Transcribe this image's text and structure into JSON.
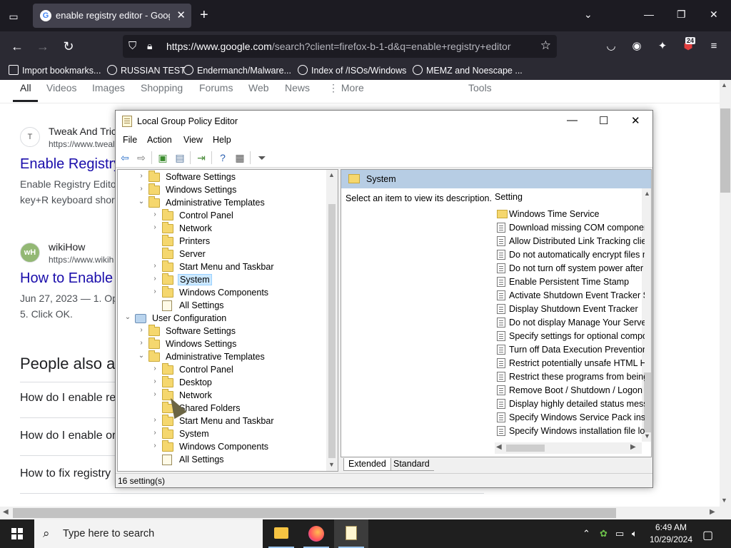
{
  "firefox": {
    "tab_title": "enable registry editor - Google Search",
    "url_host": "https://www.google.com",
    "url_rest": "/search?client=firefox-b-1-d&q=enable+registry+editor",
    "badge": "24",
    "bookmarks": [
      "Import bookmarks...",
      "RUSSIAN TEST",
      "Endermanch/Malware...",
      "Index of /ISOs/Windows",
      "MEMZ and Noescape ..."
    ]
  },
  "google": {
    "tabs": [
      "All",
      "Videos",
      "Images",
      "Shopping",
      "Forums",
      "Web",
      "News",
      "⋮ More",
      "Tools"
    ],
    "results": [
      {
        "site": "Tweak And Tric",
        "url": "https://www.tweal",
        "title": "Enable Registry",
        "snip1": "Enable Registry Edito",
        "snip2": "key+R keyboard shor",
        "fav": "T"
      },
      {
        "site": "wikiHow",
        "url": "https://www.wikih",
        "title": "How to Enable",
        "snip1": "Jun 27, 2023 — 1. Op",
        "snip2": "5. Click OK.",
        "fav": "wH"
      }
    ],
    "paa_heading": "People also a",
    "paa": [
      "How do I enable re",
      "How do I enable or",
      "How to fix registry"
    ]
  },
  "gpedit": {
    "title": "Local Group Policy Editor",
    "menu": [
      "File",
      "Action",
      "View",
      "Help"
    ],
    "tree": [
      {
        "label": "Software Settings",
        "indent": 1,
        "chev": "›",
        "icon": "folder"
      },
      {
        "label": "Windows Settings",
        "indent": 1,
        "chev": "›",
        "icon": "folder"
      },
      {
        "label": "Administrative Templates",
        "indent": 1,
        "chev": "⌄",
        "icon": "folder"
      },
      {
        "label": "Control Panel",
        "indent": 2,
        "chev": "›",
        "icon": "folder"
      },
      {
        "label": "Network",
        "indent": 2,
        "chev": "›",
        "icon": "folder"
      },
      {
        "label": "Printers",
        "indent": 2,
        "chev": "",
        "icon": "folder"
      },
      {
        "label": "Server",
        "indent": 2,
        "chev": "",
        "icon": "folder"
      },
      {
        "label": "Start Menu and Taskbar",
        "indent": 2,
        "chev": "›",
        "icon": "folder"
      },
      {
        "label": "System",
        "indent": 2,
        "chev": "›",
        "icon": "folder",
        "selected": true
      },
      {
        "label": "Windows Components",
        "indent": 2,
        "chev": "›",
        "icon": "folder"
      },
      {
        "label": "All Settings",
        "indent": 2,
        "chev": "",
        "icon": "policy"
      },
      {
        "label": "User Configuration",
        "indent": 0,
        "chev": "⌄",
        "icon": "pc"
      },
      {
        "label": "Software Settings",
        "indent": 1,
        "chev": "›",
        "icon": "folder"
      },
      {
        "label": "Windows Settings",
        "indent": 1,
        "chev": "›",
        "icon": "folder"
      },
      {
        "label": "Administrative Templates",
        "indent": 1,
        "chev": "⌄",
        "icon": "folder"
      },
      {
        "label": "Control Panel",
        "indent": 2,
        "chev": "›",
        "icon": "folder"
      },
      {
        "label": "Desktop",
        "indent": 2,
        "chev": "›",
        "icon": "folder"
      },
      {
        "label": "Network",
        "indent": 2,
        "chev": "›",
        "icon": "folder"
      },
      {
        "label": "Shared Folders",
        "indent": 2,
        "chev": "",
        "icon": "folder"
      },
      {
        "label": "Start Menu and Taskbar",
        "indent": 2,
        "chev": "›",
        "icon": "folder"
      },
      {
        "label": "System",
        "indent": 2,
        "chev": "›",
        "icon": "folder"
      },
      {
        "label": "Windows Components",
        "indent": 2,
        "chev": "›",
        "icon": "folder"
      },
      {
        "label": "All Settings",
        "indent": 2,
        "chev": "",
        "icon": "policy"
      }
    ],
    "right_header": "System",
    "description": "Select an item to view its description.",
    "setting_col": "Setting",
    "settings": [
      {
        "label": "Windows Time Service",
        "icon": "folder"
      },
      {
        "label": "Download missing COM components",
        "icon": "doc"
      },
      {
        "label": "Allow Distributed Link Tracking client",
        "icon": "doc"
      },
      {
        "label": "Do not automatically encrypt files moved",
        "icon": "doc"
      },
      {
        "label": "Do not turn off system power after",
        "icon": "doc"
      },
      {
        "label": "Enable Persistent Time Stamp",
        "icon": "doc"
      },
      {
        "label": "Activate Shutdown Event Tracker System",
        "icon": "doc"
      },
      {
        "label": "Display Shutdown Event Tracker",
        "icon": "doc"
      },
      {
        "label": "Do not display Manage Your Server",
        "icon": "doc"
      },
      {
        "label": "Specify settings for optional component",
        "icon": "doc"
      },
      {
        "label": "Turn off Data Execution Prevention",
        "icon": "doc"
      },
      {
        "label": "Restrict potentially unsafe HTML Help",
        "icon": "doc"
      },
      {
        "label": "Restrict these programs from being",
        "icon": "doc"
      },
      {
        "label": "Remove Boot / Shutdown / Logon",
        "icon": "doc"
      },
      {
        "label": "Display highly detailed status messages",
        "icon": "doc"
      },
      {
        "label": "Specify Windows Service Pack installation",
        "icon": "doc"
      },
      {
        "label": "Specify Windows installation file location",
        "icon": "doc"
      }
    ],
    "view_tabs": [
      "Extended",
      "Standard"
    ],
    "status": "16 setting(s)"
  },
  "taskbar": {
    "search_placeholder": "Type here to search",
    "time": "6:49 AM",
    "date": "10/29/2024"
  }
}
